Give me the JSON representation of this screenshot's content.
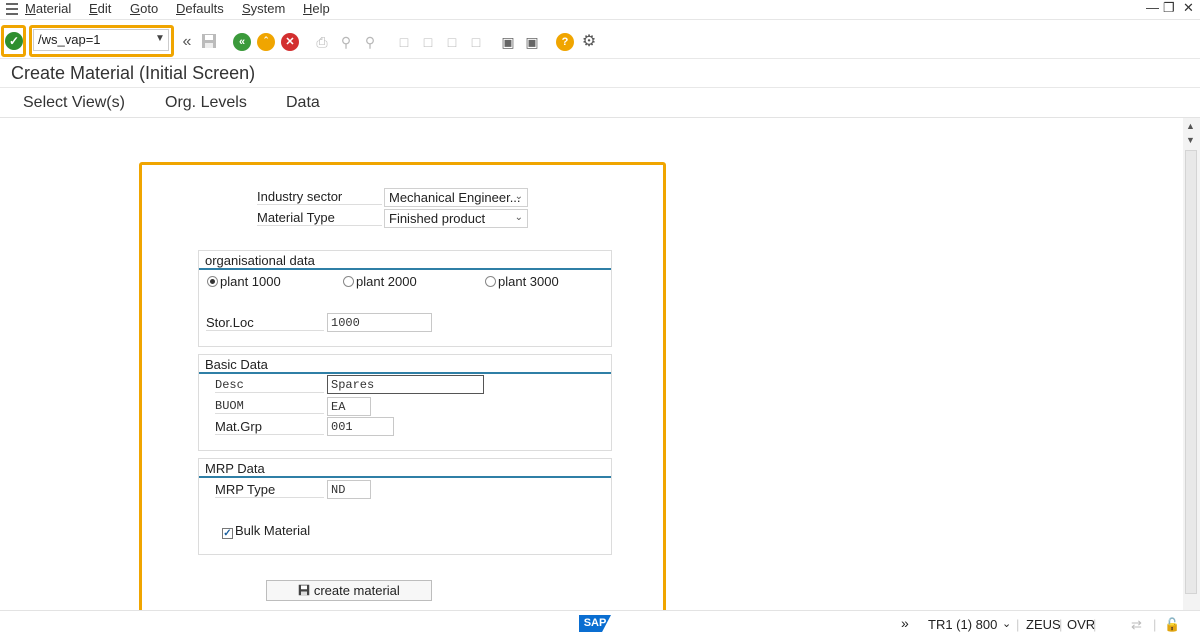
{
  "menu": {
    "items": [
      {
        "label": "Material",
        "u": "M",
        "rest": "aterial"
      },
      {
        "label": "Edit",
        "u": "E",
        "rest": "dit"
      },
      {
        "label": "Goto",
        "u": "G",
        "rest": "oto"
      },
      {
        "label": "Defaults",
        "u": "D",
        "rest": "efaults"
      },
      {
        "label": "System",
        "u": "S",
        "rest": "ystem"
      },
      {
        "label": "Help",
        "u": "H",
        "rest": "elp"
      }
    ]
  },
  "toolbar": {
    "command_value": "/ws_vap=1"
  },
  "title": "Create Material (Initial Screen)",
  "app_toolbar": {
    "select_views": "Select View(s)",
    "org_levels": "Org. Levels",
    "data": "Data"
  },
  "form": {
    "industry_sector_label": "Industry sector",
    "industry_sector_value": "Mechanical Engineer...",
    "material_type_label": "Material Type",
    "material_type_value": "Finished product",
    "org_group": {
      "title": "organisational data",
      "plant1": "plant 1000",
      "plant2": "plant 2000",
      "plant3": "plant 3000",
      "stor_loc_label": "Stor.Loc",
      "stor_loc_value": "1000"
    },
    "basic_group": {
      "title": "Basic Data",
      "desc_label": "Desc",
      "desc_value": "Spares",
      "buom_label": "BUOM",
      "buom_value": "EA",
      "matgrp_label": "Mat.Grp",
      "matgrp_value": "001"
    },
    "mrp_group": {
      "title": "MRP Data",
      "mrp_type_label": "MRP Type",
      "mrp_type_value": "ND",
      "bulk_label": "Bulk Material"
    },
    "create_button": "create material"
  },
  "status": {
    "sap": "SAP",
    "system": "TR1 (1) 800",
    "server": "ZEUS",
    "mode": "OVR"
  },
  "colors": {
    "highlight": "#f0a500",
    "group_line": "#2f7fa6",
    "sap_blue": "#0a6ed1"
  }
}
